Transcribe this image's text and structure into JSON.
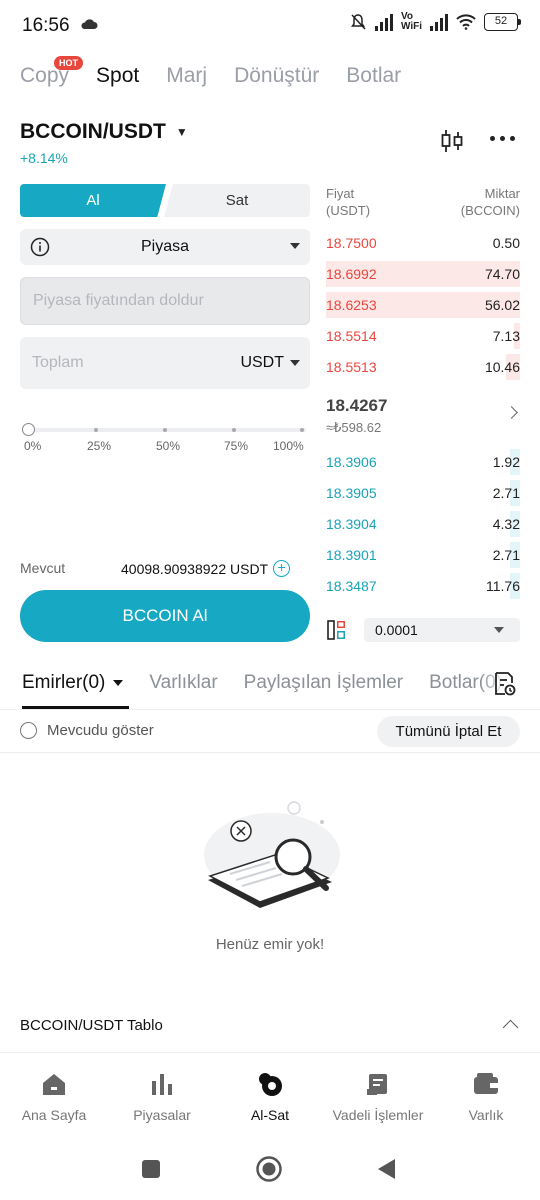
{
  "status_bar": {
    "time": "16:56",
    "network": "Vo WiFi",
    "battery": "52"
  },
  "top_tabs": [
    {
      "label": "Copy",
      "badge": "HOT"
    },
    {
      "label": "Spot",
      "active": true
    },
    {
      "label": "Marj"
    },
    {
      "label": "Dönüştür"
    },
    {
      "label": "Botlar"
    }
  ],
  "pair": {
    "symbol": "BCCOIN/USDT",
    "change": "+8.14%"
  },
  "trade_form": {
    "buy_label": "Al",
    "sell_label": "Sat",
    "order_type": "Piyasa",
    "price_placeholder": "Piyasa fiyatından doldur",
    "total_placeholder": "Toplam",
    "total_unit": "USDT",
    "slider_labels": [
      "0%",
      "25%",
      "50%",
      "75%",
      "100%"
    ],
    "available_label": "Mevcut",
    "available_value": "40098.90938922 USDT",
    "submit_label": "BCCOIN Al"
  },
  "order_book": {
    "price_header": "Fiyat\n(USDT)",
    "qty_header": "Miktar\n(BCCOIN)",
    "asks": [
      {
        "price": "18.7500",
        "qty": "0.50",
        "depth": 0.0
      },
      {
        "price": "18.6992",
        "qty": "74.70",
        "depth": 1.0
      },
      {
        "price": "18.6253",
        "qty": "56.02",
        "depth": 1.0
      },
      {
        "price": "18.5514",
        "qty": "7.13",
        "depth": 0.03
      },
      {
        "price": "18.5513",
        "qty": "10.46",
        "depth": 0.07
      }
    ],
    "last_price": "18.4267",
    "last_price_fiat": "≈₺598.62",
    "bids": [
      {
        "price": "18.3906",
        "qty": "1.92",
        "depth": 0.05
      },
      {
        "price": "18.3905",
        "qty": "2.71",
        "depth": 0.05
      },
      {
        "price": "18.3904",
        "qty": "4.32",
        "depth": 0.05
      },
      {
        "price": "18.3901",
        "qty": "2.71",
        "depth": 0.05
      },
      {
        "price": "18.3487",
        "qty": "11.76",
        "depth": 0.05
      }
    ],
    "precision": "0.0001"
  },
  "orders": {
    "tabs": [
      "Emirler(0)",
      "Varlıklar",
      "Paylaşılan İşlemler",
      "Botlar(0)"
    ],
    "show_current_label": "Mevcudu göster",
    "cancel_all_label": "Tümünü İptal Et",
    "empty_text": "Henüz emir yok!"
  },
  "chart_section": {
    "label": "BCCOIN/USDT Tablo"
  },
  "bottom_nav": [
    {
      "label": "Ana Sayfa",
      "icon": "home-icon"
    },
    {
      "label": "Piyasalar",
      "icon": "bar-chart-icon"
    },
    {
      "label": "Al-Sat",
      "icon": "trade-icon",
      "active": true
    },
    {
      "label": "Vadeli İşlemler",
      "icon": "futures-icon"
    },
    {
      "label": "Varlık",
      "icon": "wallet-icon"
    }
  ],
  "colors": {
    "accent": "#17a9c4",
    "ask": "#e8473e",
    "bid": "#1aa3b5"
  }
}
